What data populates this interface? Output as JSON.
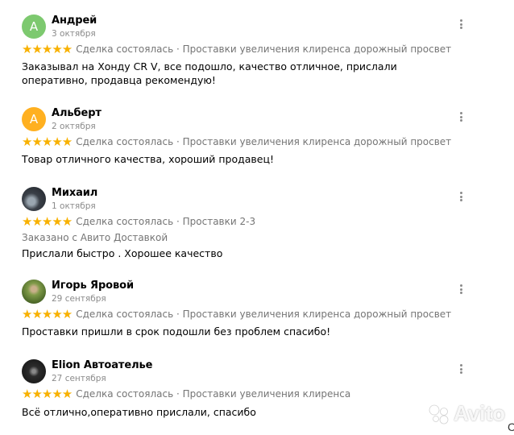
{
  "reviews": [
    {
      "author": "Андрей",
      "date": "3 октября",
      "avatar": {
        "letter": "А",
        "color": "#7dc96f"
      },
      "rating": 5,
      "stars": "★★★★★",
      "meta": "Сделка состоялась · Проставки увеличения клиренса дорожный просвет",
      "delivery": "",
      "text": "Заказывал на Хонду CR V, все подошло, качество отличное, прислали оперативно, продавца рекомендую!"
    },
    {
      "author": "Альберт",
      "date": "2 октября",
      "avatar": {
        "letter": "А",
        "color": "#ffb020"
      },
      "rating": 5,
      "stars": "★★★★★",
      "meta": "Сделка состоялась · Проставки увеличения клиренса дорожный просвет",
      "delivery": "",
      "text": "Товар отличного качества, хороший продавец!"
    },
    {
      "author": "Михаил",
      "date": "1 октября",
      "avatar": {
        "letter": "",
        "color": "#3a4048"
      },
      "rating": 5,
      "stars": "★★★★★",
      "meta": "Сделка состоялась · Проставки 2-3",
      "delivery": "Заказано с Авито Доставкой",
      "text": "Прислали быстро . Хорошее качество"
    },
    {
      "author": "Игорь Яровой",
      "date": "29 сентября",
      "avatar": {
        "letter": "",
        "color": "#6f8a3c"
      },
      "rating": 5,
      "stars": "★★★★★",
      "meta": "Сделка состоялась · Проставки увеличения клиренса дорожный просвет",
      "delivery": "",
      "text": "Проставки пришли в срок подошли без проблем спасибо!"
    },
    {
      "author": "Elion Автоателье",
      "date": "27 сентября",
      "avatar": {
        "letter": "",
        "color": "#2c2c2c"
      },
      "rating": 5,
      "stars": "★★★★★",
      "meta": "Сделка состоялась · Проставки увеличения клиренса",
      "delivery": "",
      "text": "Всё отлично,оперативно прислали, спасибо"
    }
  ],
  "watermark": "Avito",
  "edge_glyph": "C"
}
